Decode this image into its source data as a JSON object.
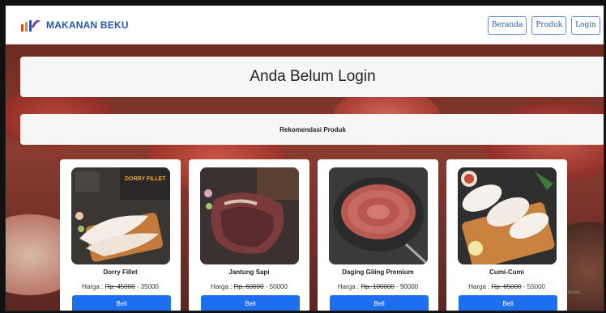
{
  "navbar": {
    "brand": "MAKANAN BEKU",
    "links": [
      "Beranda",
      "Produk",
      "Login"
    ]
  },
  "hero": {
    "title": "Anda Belum Login"
  },
  "recommendation": {
    "title": "Rekomendasi Produk"
  },
  "products": [
    {
      "name": "Dorry Fillet",
      "price_prefix": "Harga : ",
      "old_price": "Rp. 45000",
      "new_price": " - 35000",
      "button": "Beli",
      "image_label": "DORRY FILLET"
    },
    {
      "name": "Jantung Sapi",
      "price_prefix": "Harga : ",
      "old_price": "Rp. 60000",
      "new_price": " - 50000",
      "button": "Beli"
    },
    {
      "name": "Daging Giling Premium",
      "price_prefix": "Harga : ",
      "old_price": "Rp. 100000",
      "new_price": " - 90000",
      "button": "Beli"
    },
    {
      "name": "Cumi-Cumi",
      "price_prefix": "Harga : ",
      "old_price": "Rp. 65000",
      "new_price": " - 55000",
      "button": "Beli"
    }
  ],
  "watermark": {
    "title": "Activate Windows",
    "subtitle": "Go to Settings to activate Windows."
  },
  "colors": {
    "brand": "#2a56a8",
    "button": "#1e6ff0"
  }
}
